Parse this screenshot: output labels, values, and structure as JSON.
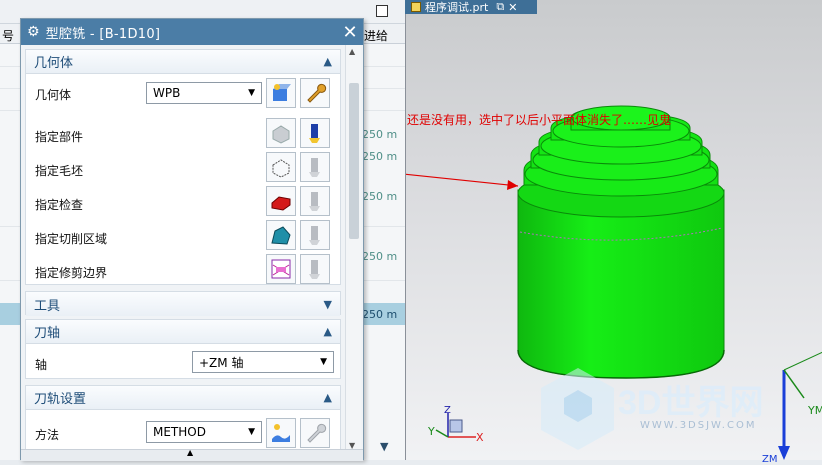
{
  "background_table": {
    "header_left": "号",
    "header_right": "进给",
    "values": [
      "250 m",
      "250 m",
      "250 m",
      "250 m",
      "250 m"
    ]
  },
  "dialog": {
    "title": "型腔铣 - [B-1D10]",
    "close_label": "✕",
    "groups": {
      "geometry": {
        "title": "几何体",
        "geometry_label": "几何体",
        "geometry_value": "WPB",
        "rows": [
          "指定部件",
          "指定毛坯",
          "指定检查",
          "指定切削区域",
          "指定修剪边界"
        ]
      },
      "tools": {
        "title": "工具"
      },
      "tool_axis": {
        "title": "刀轴",
        "axis_label": "轴",
        "axis_value": "+ZM 轴"
      },
      "path_settings": {
        "title": "刀轨设置",
        "method_label": "方法",
        "method_value": "METHOD"
      }
    }
  },
  "viewport": {
    "tab_title": "程序调试.prt",
    "annotation": "还是没有用，选中了以后小平面体消失了……见鬼",
    "watermark_brand": "3D世界网",
    "watermark_url": "WWW.3DSJW.COM",
    "axis_x": "X",
    "axis_y": "Y",
    "axis_z": "Z",
    "axis_ym": "YM",
    "axis_zm": "ZM"
  },
  "colors": {
    "model_green": "#12e612",
    "title_blue": "#4b7da6",
    "annotation_red": "#e00000"
  }
}
